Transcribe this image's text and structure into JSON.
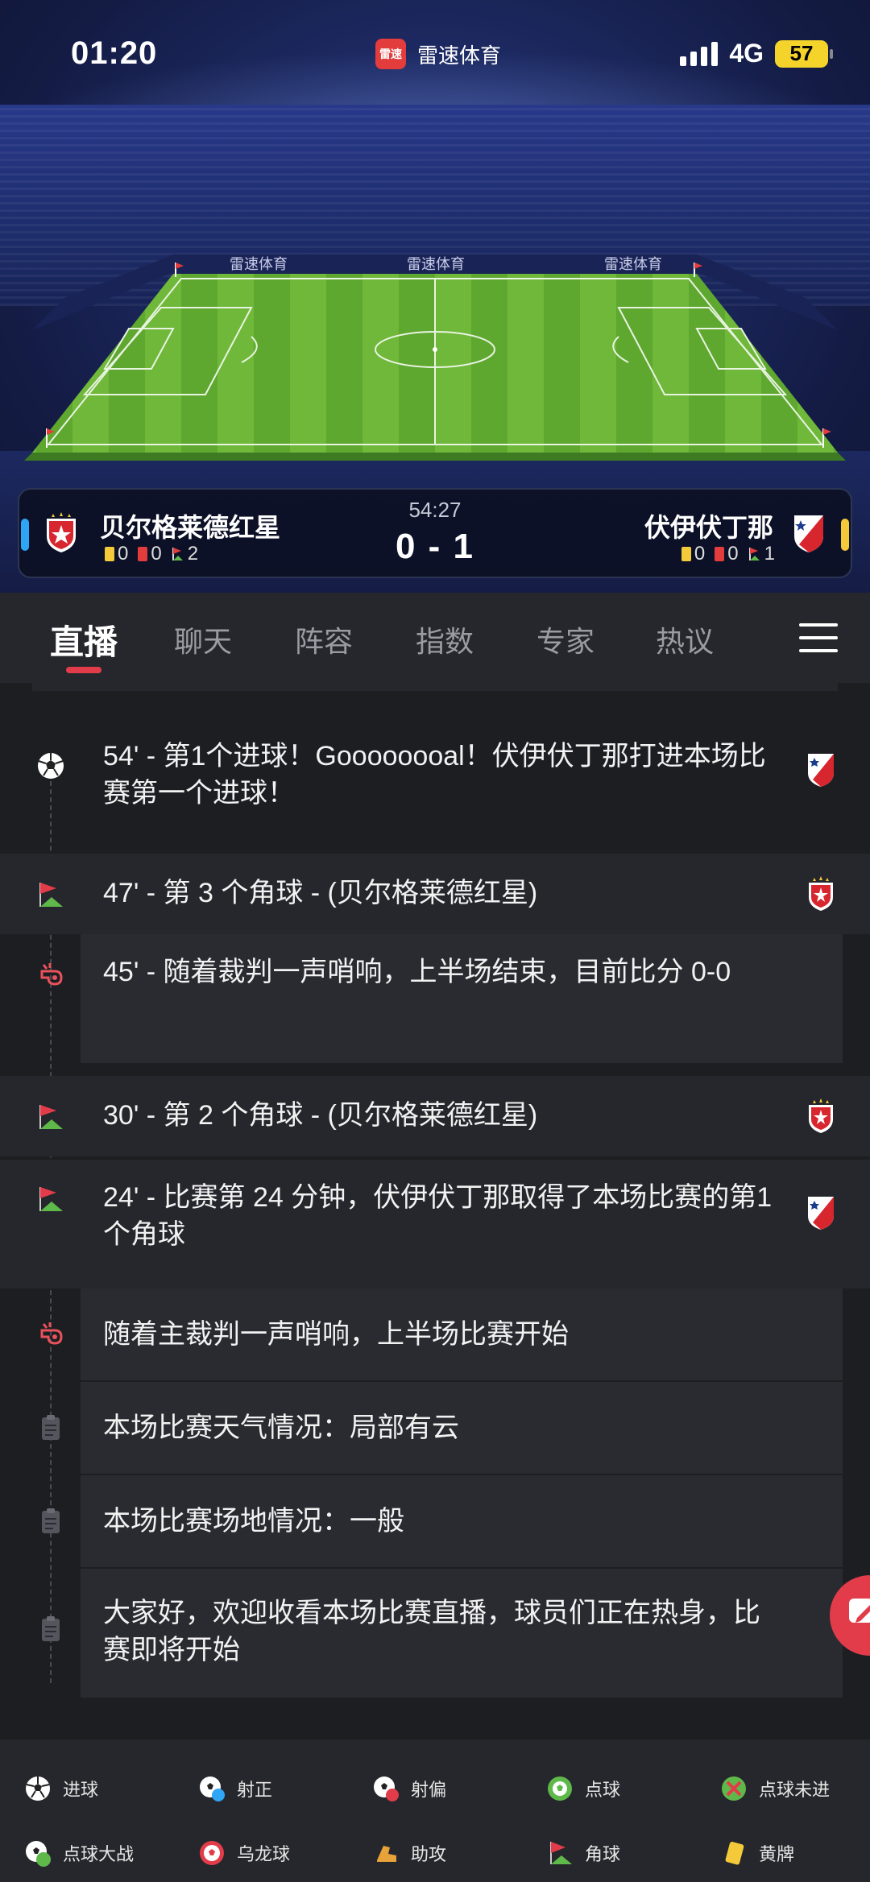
{
  "status_bar": {
    "time": "01:20",
    "app_name": "雷速体育",
    "app_logo_text": "雷速",
    "network": "4G",
    "battery": "57"
  },
  "match": {
    "clock": "54:27",
    "score": "0 - 1",
    "home": {
      "name": "贝尔格莱德红星",
      "yellow": "0",
      "red": "0",
      "corners": "2",
      "color": "#2fa6f5"
    },
    "away": {
      "name": "伏伊伏丁那",
      "yellow": "0",
      "red": "0",
      "corners": "1",
      "color": "#f4c93a"
    },
    "board_text": "雷速体育"
  },
  "tabs": [
    {
      "label": "直播"
    },
    {
      "label": "聊天"
    },
    {
      "label": "阵容"
    },
    {
      "label": "指数"
    },
    {
      "label": "专家"
    },
    {
      "label": "热议"
    }
  ],
  "events": [
    {
      "icon": "soccer-ball-icon",
      "text": "54' - 第1个进球！Goooooooal！伏伊伏丁那打进本场比赛第一个进球！",
      "team": "away"
    },
    {
      "icon": "corner-flag-icon",
      "text": "47' - 第 3 个角球 - (贝尔格莱德红星)",
      "team": "home"
    },
    {
      "icon": "whistle-icon",
      "text": "45' - 随着裁判一声哨响，上半场结束，目前比分 0-0",
      "team": ""
    },
    {
      "icon": "corner-flag-icon",
      "text": "30' - 第 2 个角球 - (贝尔格莱德红星)",
      "team": "home"
    },
    {
      "icon": "corner-flag-icon",
      "text": "24' - 比赛第 24 分钟，伏伊伏丁那取得了本场比赛的第1个角球",
      "team": "away"
    },
    {
      "icon": "whistle-icon",
      "text": "随着主裁判一声哨响，上半场比赛开始",
      "team": ""
    },
    {
      "icon": "clipboard-icon",
      "text": "本场比赛天气情况：局部有云",
      "team": ""
    },
    {
      "icon": "clipboard-icon",
      "text": "本场比赛场地情况：一般",
      "team": ""
    },
    {
      "icon": "clipboard-icon",
      "text": "大家好，欢迎收看本场比赛直播，球员们正在热身，比赛即将开始",
      "team": ""
    }
  ],
  "legend": [
    {
      "icon": "soccer-ball-icon",
      "label": "进球"
    },
    {
      "icon": "shot-on-target-icon",
      "label": "射正"
    },
    {
      "icon": "shot-off-target-icon",
      "label": "射偏"
    },
    {
      "icon": "penalty-icon",
      "label": "点球"
    },
    {
      "icon": "penalty-missed-icon",
      "label": "点球未进"
    },
    {
      "icon": "penalty-shootout-icon",
      "label": "点球大战"
    },
    {
      "icon": "own-goal-icon",
      "label": "乌龙球"
    },
    {
      "icon": "assist-icon",
      "label": "助攻"
    },
    {
      "icon": "corner-flag-icon",
      "label": "角球"
    },
    {
      "icon": "yellow-card-icon",
      "label": "黄牌"
    }
  ]
}
